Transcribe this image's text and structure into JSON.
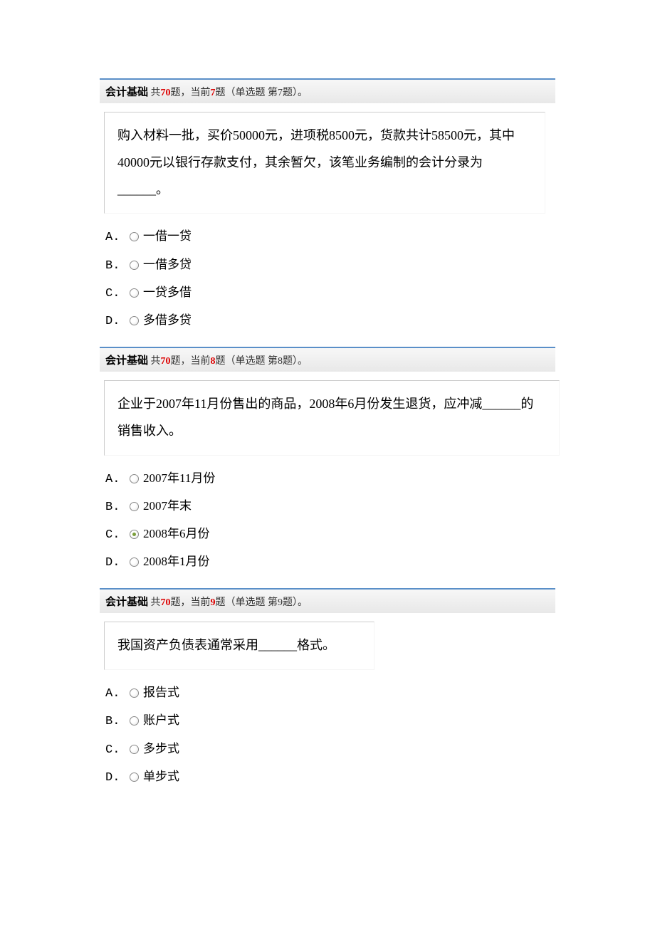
{
  "quiz": {
    "subject": "会计基础",
    "total_label_prefix": " 共",
    "total": "70",
    "total_label_suffix": "题，当前",
    "unit_suffix": "题"
  },
  "questions": [
    {
      "current": "7",
      "type_label": "（单选题  第7题）。",
      "text": "购入材料一批，买价50000元，进项税8500元，货款共计58500元，其中40000元以银行存款支付，其余暂欠，该笔业务编制的会计分录为______。",
      "options": [
        {
          "letter": "A.",
          "text": "一借一贷",
          "checked": false
        },
        {
          "letter": "B.",
          "text": "一借多贷",
          "checked": false
        },
        {
          "letter": "C.",
          "text": "一贷多借",
          "checked": false
        },
        {
          "letter": "D.",
          "text": "多借多贷",
          "checked": false
        }
      ]
    },
    {
      "current": "8",
      "type_label": "（单选题  第8题）。",
      "text": "企业于2007年11月份售出的商品，2008年6月份发生退货，应冲减______的销售收入。",
      "options": [
        {
          "letter": "A.",
          "text": "2007年11月份",
          "checked": false
        },
        {
          "letter": "B.",
          "text": "2007年末",
          "checked": false
        },
        {
          "letter": "C.",
          "text": "2008年6月份",
          "checked": true
        },
        {
          "letter": "D.",
          "text": "2008年1月份",
          "checked": false
        }
      ]
    },
    {
      "current": "9",
      "type_label": "（单选题  第9题）。",
      "text": "我国资产负债表通常采用______格式。",
      "options": [
        {
          "letter": "A.",
          "text": "报告式",
          "checked": false
        },
        {
          "letter": "B.",
          "text": "账户式",
          "checked": false
        },
        {
          "letter": "C.",
          "text": "多步式",
          "checked": false
        },
        {
          "letter": "D.",
          "text": "单步式",
          "checked": false
        }
      ]
    }
  ]
}
